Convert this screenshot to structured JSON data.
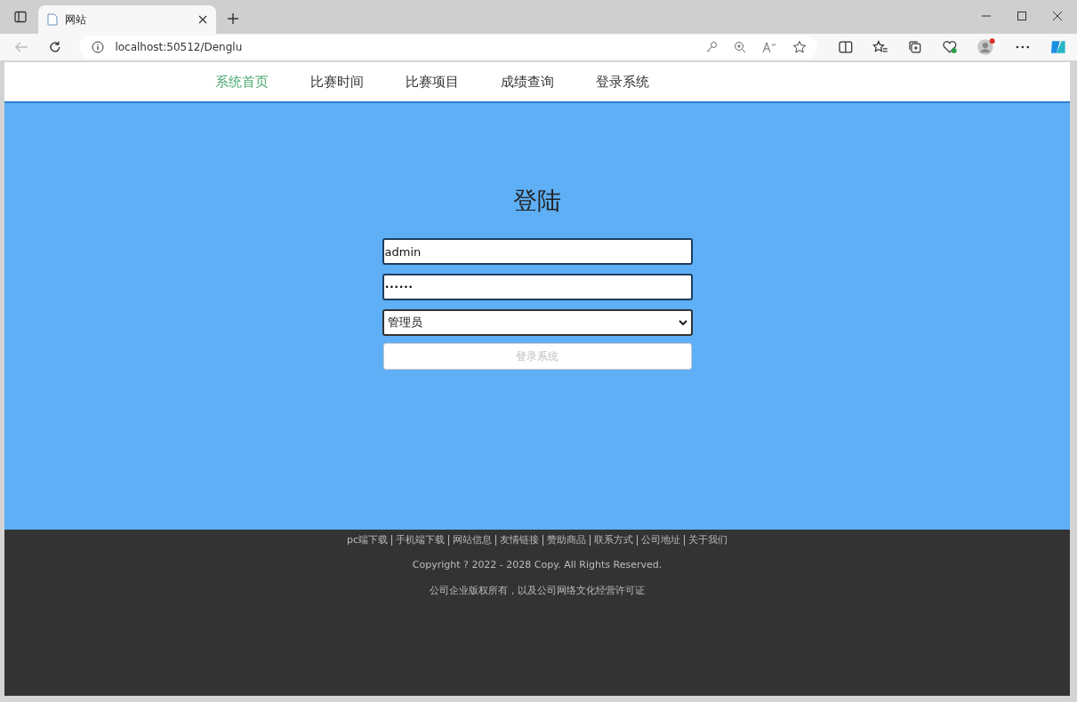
{
  "browser": {
    "tab_title": "网站",
    "address": "localhost:50512/Denglu"
  },
  "nav": [
    {
      "label": "系统首页",
      "selected": true
    },
    {
      "label": "比赛时间",
      "selected": false
    },
    {
      "label": "比赛项目",
      "selected": false
    },
    {
      "label": "成绩查询",
      "selected": false
    },
    {
      "label": "登录系统",
      "selected": false
    }
  ],
  "login": {
    "title": "登陆",
    "username": "admin",
    "password": "••••••",
    "role": "管理员",
    "submit": "登录系统"
  },
  "footer": {
    "links": [
      "pc端下载",
      "手机端下载",
      "网站信息",
      "友情链接",
      "赞助商品",
      "联系方式",
      "公司地址",
      "关于我们"
    ],
    "copyright": "Copyright ? 2022 - 2028 Copy. All Rights Reserved.",
    "license": "公司企业版权所有，以及公司网络文化经营许可证"
  }
}
